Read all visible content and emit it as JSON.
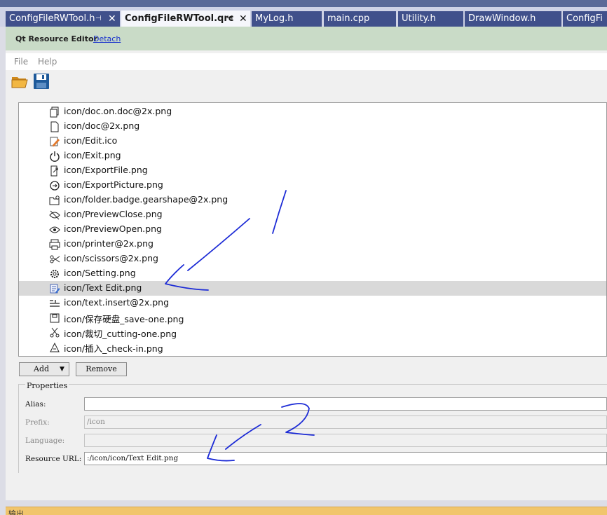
{
  "tabs": [
    {
      "label": "ConfigFileRWTool.h",
      "pinned": true
    },
    {
      "label": "ConfigFileRWTool.qrc",
      "pinned": true,
      "active": true
    },
    {
      "label": "MyLog.h"
    },
    {
      "label": "main.cpp"
    },
    {
      "label": "Utility.h"
    },
    {
      "label": "DrawWindow.h"
    },
    {
      "label": "ConfigFi"
    }
  ],
  "tab_glyphs": {
    "pin": "⊣",
    "close": "✕"
  },
  "editor": {
    "title": "Qt Resource Editor",
    "detach": "Detach"
  },
  "menu": {
    "file": "File",
    "help": "Help"
  },
  "toolbar": [
    {
      "icon": "open-folder-icon"
    },
    {
      "icon": "save-disk-icon"
    }
  ],
  "files": [
    {
      "label": "icon/doc.on.doc@2x.png",
      "icon": "docs-icon"
    },
    {
      "label": "icon/doc@2x.png",
      "icon": "doc-icon"
    },
    {
      "label": "icon/Edit.ico",
      "icon": "edit-icon"
    },
    {
      "label": "icon/Exit.png",
      "icon": "power-icon"
    },
    {
      "label": "icon/ExportFile.png",
      "icon": "export-file-icon"
    },
    {
      "label": "icon/ExportPicture.png",
      "icon": "export-picture-icon"
    },
    {
      "label": "icon/folder.badge.gearshape@2x.png",
      "icon": "folder-gear-icon"
    },
    {
      "label": "icon/PreviewClose.png",
      "icon": "eye-off-icon"
    },
    {
      "label": "icon/PreviewOpen.png",
      "icon": "eye-icon"
    },
    {
      "label": "icon/printer@2x.png",
      "icon": "printer-icon"
    },
    {
      "label": "icon/scissors@2x.png",
      "icon": "scissors-icon"
    },
    {
      "label": "icon/Setting.png",
      "icon": "gear-icon"
    },
    {
      "label": "icon/Text Edit.png",
      "icon": "text-edit-icon",
      "selected": true
    },
    {
      "label": "icon/text.insert@2x.png",
      "icon": "text-insert-icon"
    },
    {
      "label": "icon/保存硬盘_save-one.png",
      "icon": "save-one-icon"
    },
    {
      "label": "icon/裁切_cutting-one.png",
      "icon": "cutting-icon"
    },
    {
      "label": "icon/插入_check-in.png",
      "icon": "check-in-icon"
    }
  ],
  "buttons": {
    "add": "Add",
    "remove": "Remove",
    "dropdown": "▼"
  },
  "properties": {
    "title": "Properties",
    "alias": {
      "label": "Alias:",
      "value": ""
    },
    "prefix": {
      "label": "Prefix:",
      "value": "/icon",
      "disabled": true
    },
    "language": {
      "label": "Language:",
      "value": "",
      "disabled": true
    },
    "resource_url": {
      "label": "Resource URL:",
      "value": ":/icon/icon/Text Edit.png"
    }
  },
  "output_panel": {
    "label": "输出"
  },
  "colors": {
    "tab_bg": "#40508b",
    "selection": "#d9d9d9",
    "editor_bar": "#c9dbc7",
    "annotation_ink": "#1c2bd6",
    "output_bar": "#f1c56c"
  }
}
